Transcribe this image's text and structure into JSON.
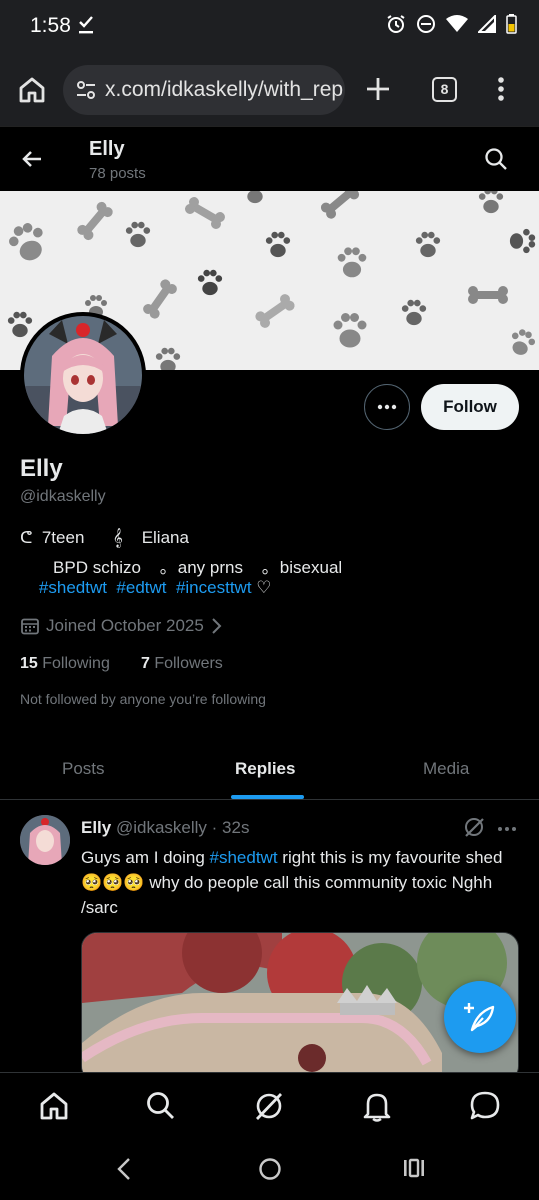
{
  "status": {
    "time": "1:58"
  },
  "browser": {
    "url": "x.com/idkaskelly/with_rep",
    "tab_count": "8"
  },
  "header": {
    "name": "Elly",
    "posts": "78 posts"
  },
  "profile": {
    "follow_label": "Follow",
    "name": "Elly",
    "handle": "@idkaskelly",
    "bio_line1_a": "ᕦ  7teen",
    "bio_line1_b": "𝄞    Eliana",
    "bio_line2": "       BPD schizo    ｡  any prns    ｡  bisexual",
    "bio_tags": [
      "#shedtwt",
      "#edtwt",
      "#incesttwt"
    ],
    "bio_heart": "♡",
    "joined": "Joined October 2025",
    "following_count": "15",
    "following_label": "Following",
    "followers_count": "7",
    "followers_label": "Followers",
    "not_followed": "Not followed by anyone you’re following"
  },
  "tabs": {
    "posts": "Posts",
    "replies": "Replies",
    "media": "Media"
  },
  "tweet": {
    "name": "Elly",
    "handle_time": "@idkaskelly · 32s",
    "text_before": "Guys am I doing ",
    "hashtag": "#shedtwt",
    "text_after": " right this is my favourite shed 🥺🥺🥺 why do people call this community toxic Nghh /sarc"
  },
  "colors": {
    "accent": "#1d9bf0",
    "background": "#000000",
    "muted": "#71767b",
    "text": "#e7e9ea"
  }
}
